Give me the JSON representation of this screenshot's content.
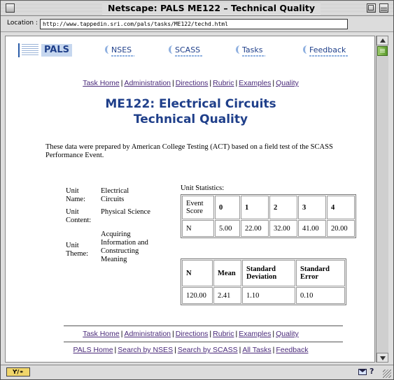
{
  "window": {
    "title": "Netscape: PALS ME122 – Technical Quality",
    "location_label": "Location :",
    "url": "http://www.tappedin.sri.com/pals/tasks/ME122/techd.html",
    "status_badge": "Ƴ/⚭"
  },
  "header": {
    "logo_text": "PALS",
    "nav": [
      "NSES",
      "SCASS",
      "Tasks",
      "Feedback"
    ]
  },
  "top_links": [
    "Task Home",
    "Administration",
    "Directions",
    "Rubric",
    "Examples",
    "Quality"
  ],
  "page": {
    "heading_line1": "ME122: Electrical Circuits",
    "heading_line2": "Technical Quality",
    "intro": "These data were prepared by American College Testing (ACT) based on a field test of the SCASS Performance Event."
  },
  "unit_info": [
    {
      "label": "Unit Name:",
      "value": "Electrical Circuits"
    },
    {
      "label": "Unit Content:",
      "value": "Physical Science"
    },
    {
      "label": "Unit Theme:",
      "value": "Acquiring Information and Constructing Meaning"
    }
  ],
  "stats": {
    "caption": "Unit Statistics:",
    "score_table": {
      "header": [
        "Event Score",
        "0",
        "1",
        "2",
        "3",
        "4"
      ],
      "row": [
        "N",
        "5.00",
        "22.00",
        "32.00",
        "41.00",
        "20.00"
      ]
    },
    "summary_table": {
      "header": [
        "N",
        "Mean",
        "Standard Deviation",
        "Standard Error"
      ],
      "row": [
        "120.00",
        "2.41",
        "1.10",
        "0.10"
      ]
    }
  },
  "bottom_links_1": [
    "Task Home",
    "Administration",
    "Directions",
    "Rubric",
    "Examples",
    "Quality"
  ],
  "bottom_links_2": [
    "PALS Home",
    "Search by NSES",
    "Search by SCASS",
    "All Tasks",
    "Feedback"
  ]
}
